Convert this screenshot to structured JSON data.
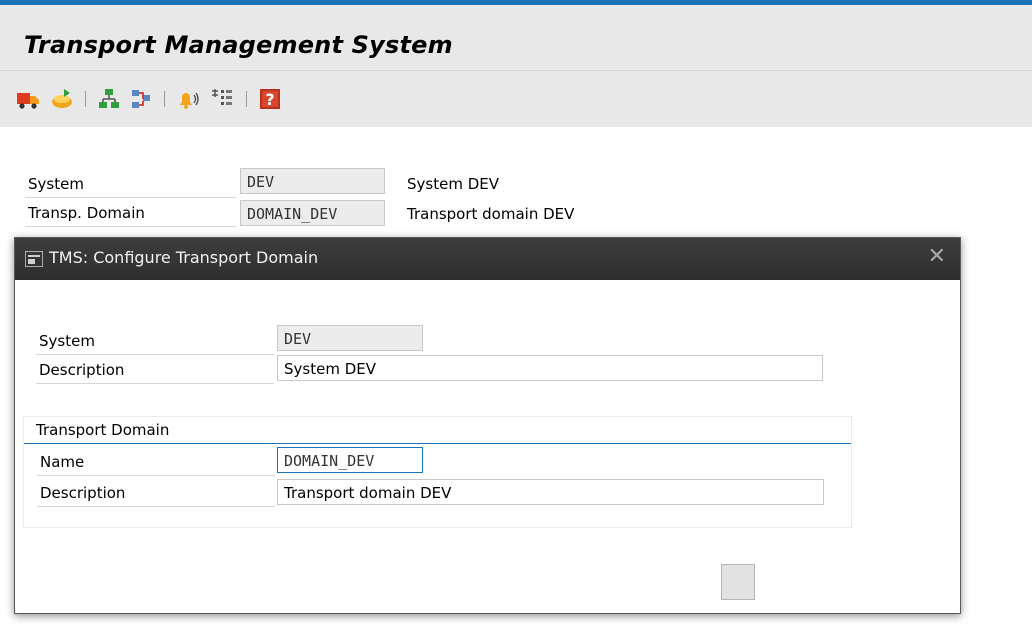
{
  "app": {
    "title": "Transport Management System"
  },
  "toolbar": {
    "icons": [
      "truck-icon",
      "transport-open-icon",
      "hierarchy-icon",
      "network-icon",
      "alert-bell-icon",
      "list-icon",
      "help-icon"
    ]
  },
  "main": {
    "system_label": "System",
    "system_value": "DEV",
    "system_desc": "System DEV",
    "domain_label": "Transp. Domain",
    "domain_value": "DOMAIN_DEV",
    "domain_desc": "Transport domain DEV"
  },
  "dialog": {
    "title": "TMS: Configure Transport Domain",
    "close": "✕",
    "system_label": "System",
    "system_value": "DEV",
    "description_label": "Description",
    "description_value": "System DEV",
    "group_title": "Transport Domain",
    "name_label": "Name",
    "name_value": "DOMAIN_DEV",
    "domain_desc_label": "Description",
    "domain_desc_value": "Transport domain DEV"
  },
  "colors": {
    "accent": "#1a73b8",
    "header_bg": "#e8e8e8",
    "dialog_header": "#333333"
  }
}
